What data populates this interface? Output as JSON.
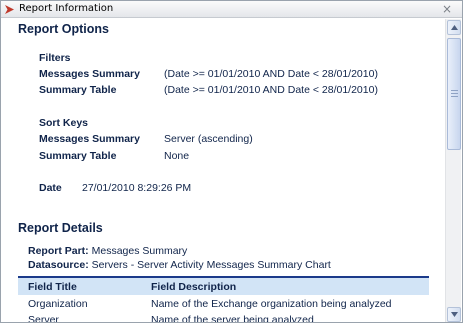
{
  "window": {
    "title": "Report Information",
    "close_glyph": "×"
  },
  "options": {
    "heading": "Report Options",
    "filters": {
      "heading": "Filters",
      "rows": [
        {
          "label": "Messages Summary",
          "value": "(Date >= 01/01/2010 AND Date < 28/01/2010)"
        },
        {
          "label": "Summary Table",
          "value": "(Date >= 01/01/2010 AND Date < 28/01/2010)"
        }
      ]
    },
    "sort_keys": {
      "heading": "Sort Keys",
      "rows": [
        {
          "label": "Messages Summary",
          "value": "Server (ascending)"
        },
        {
          "label": "Summary Table",
          "value": "None"
        }
      ]
    },
    "date": {
      "label": "Date",
      "value": "27/01/2010 8:29:26 PM"
    }
  },
  "details": {
    "heading": "Report Details",
    "report_part": {
      "label": "Report Part:",
      "value": "Messages Summary"
    },
    "datasource": {
      "label": "Datasource:",
      "value": "Servers - Server Activity Messages Summary Chart"
    },
    "table": {
      "columns": [
        "Field Title",
        "Field Description"
      ],
      "rows": [
        [
          "Organization",
          "Name of the Exchange organization being analyzed"
        ],
        [
          "Server",
          "Name of the server being analyzed"
        ]
      ]
    }
  },
  "icons": {
    "title_icon": "report-app-icon",
    "close": "close-icon",
    "scroll_up": "arrow-up-icon",
    "scroll_down": "arrow-down-icon"
  },
  "colors": {
    "text": "#10244a",
    "table_header_bg": "#d2e4f6",
    "table_header_border": "#1b3a8a",
    "app_icon": "#c0392b"
  }
}
